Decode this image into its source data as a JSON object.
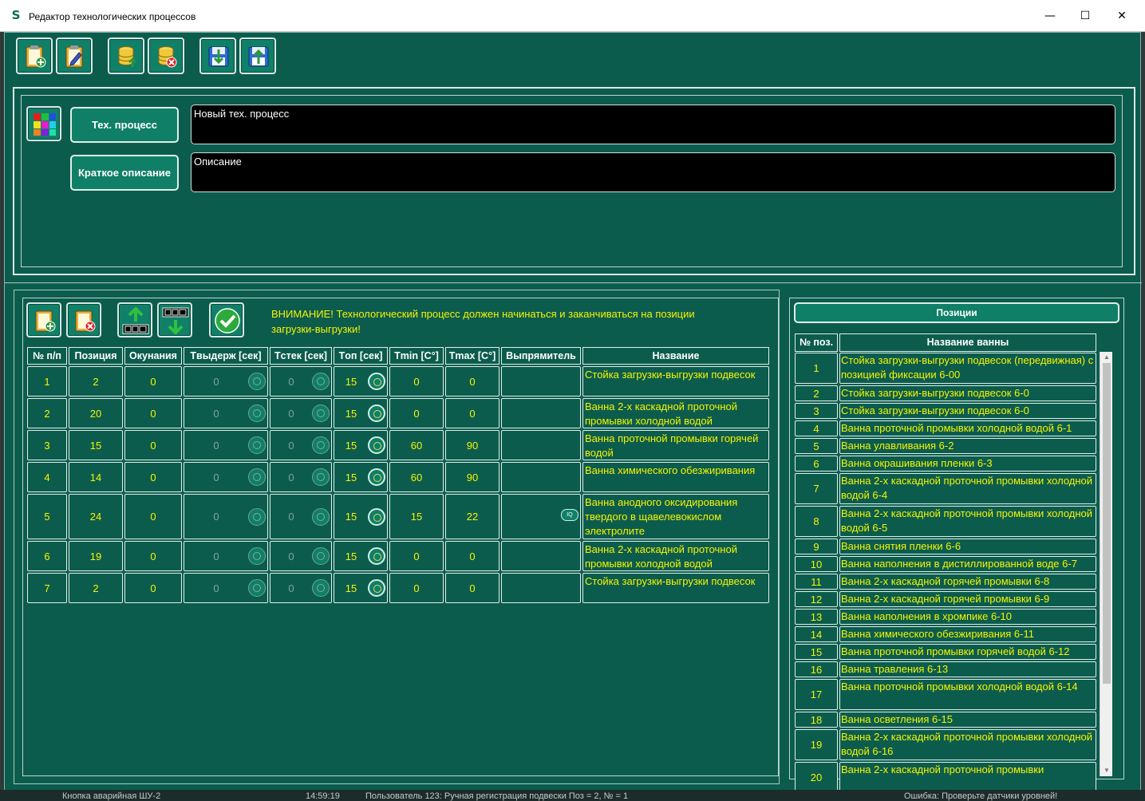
{
  "window": {
    "title": "Редактор технологических процессов",
    "icon_glyph": "S",
    "minimize_glyph": "—",
    "maximize_glyph": "☐",
    "close_glyph": "✕"
  },
  "toolbar": {
    "icons": [
      "new-document-icon",
      "edit-document-icon",
      "db-upload-icon",
      "db-delete-icon",
      "download-to-disk-icon",
      "upload-from-disk-icon"
    ]
  },
  "process": {
    "palette_icon": "color-palette-icon",
    "tech_process_label": "Тех. процесс",
    "tech_process_value": "Новый тех. процесс",
    "description_label": "Краткое описание",
    "description_value": "Описание"
  },
  "steps_toolbar": {
    "icons": [
      "add-step-icon",
      "delete-step-icon",
      "move-up-icon",
      "move-down-icon",
      "confirm-icon"
    ],
    "warning_line1": "ВНИМАНИЕ! Технологический процесс должен начинаться и заканчиваться на позиции",
    "warning_line2": "загрузки-выгрузки!"
  },
  "steps_table": {
    "headers": [
      "№ п/п",
      "Позиция",
      "Окунания",
      "Tвыдерж [сек]",
      "Tстек [сек]",
      "Tоп [сек]",
      "Tmin [C°]",
      "Tmax [C°]",
      "Выпрямитель",
      "Название"
    ],
    "rows": [
      {
        "n": "1",
        "pos": "2",
        "dips": "0",
        "hold": "0",
        "drip": "0",
        "top": "15",
        "tmin": "0",
        "tmax": "0",
        "rect": "",
        "name": "Стойка загрузки-выгрузки подвесок"
      },
      {
        "n": "2",
        "pos": "20",
        "dips": "0",
        "hold": "0",
        "drip": "0",
        "top": "15",
        "tmin": "0",
        "tmax": "0",
        "rect": "",
        "name": "Ванна 2-х каскадной проточной промывки холодной водой"
      },
      {
        "n": "3",
        "pos": "15",
        "dips": "0",
        "hold": "0",
        "drip": "0",
        "top": "15",
        "tmin": "60",
        "tmax": "90",
        "rect": "",
        "name": "Ванна проточной промывки горячей водой"
      },
      {
        "n": "4",
        "pos": "14",
        "dips": "0",
        "hold": "0",
        "drip": "0",
        "top": "15",
        "tmin": "60",
        "tmax": "90",
        "rect": "",
        "name": "Ванна химического обезжиривания"
      },
      {
        "n": "5",
        "pos": "24",
        "dips": "0",
        "hold": "0",
        "drip": "0",
        "top": "15",
        "tmin": "15",
        "tmax": "22",
        "rect": "IQ",
        "name": "Ванна анодного оксидирования твердого в щавелевокислом электролите"
      },
      {
        "n": "6",
        "pos": "19",
        "dips": "0",
        "hold": "0",
        "drip": "0",
        "top": "15",
        "tmin": "0",
        "tmax": "0",
        "rect": "",
        "name": "Ванна 2-х каскадной проточной промывки холодной водой"
      },
      {
        "n": "7",
        "pos": "2",
        "dips": "0",
        "hold": "0",
        "drip": "0",
        "top": "15",
        "tmin": "0",
        "tmax": "0",
        "rect": "",
        "name": "Стойка загрузки-выгрузки подвесок"
      }
    ]
  },
  "positions": {
    "title": "Позиции",
    "headers": [
      "№ поз.",
      "Название ванны"
    ],
    "rows": [
      {
        "n": "1",
        "name": "Стойка загрузки-выгрузки подвесок (передвижная)  с позицией фиксации 6-00"
      },
      {
        "n": "2",
        "name": "Стойка загрузки-выгрузки подвесок 6-0"
      },
      {
        "n": "3",
        "name": "Стойка загрузки-выгрузки подвесок 6-0"
      },
      {
        "n": "4",
        "name": "Ванна проточной промывки холодной водой 6-1"
      },
      {
        "n": "5",
        "name": "Ванна улавливания 6-2"
      },
      {
        "n": "6",
        "name": "Ванна окрашивания пленки 6-3"
      },
      {
        "n": "7",
        "name": "Ванна 2-х каскадной проточной промывки холодной водой 6-4"
      },
      {
        "n": "8",
        "name": "Ванна 2-х каскадной проточной промывки холодной водой 6-5"
      },
      {
        "n": "9",
        "name": "Ванна снятия пленки 6-6"
      },
      {
        "n": "10",
        "name": "Ванна наполнения в дистиллированной воде 6-7"
      },
      {
        "n": "11",
        "name": "Ванна 2-х каскадной горячей промывки 6-8"
      },
      {
        "n": "12",
        "name": "Ванна 2-х каскадной горячей промывки 6-9"
      },
      {
        "n": "13",
        "name": "Ванна наполнения в хромпике 6-10"
      },
      {
        "n": "14",
        "name": "Ванна химического обезжиривания 6-11"
      },
      {
        "n": "15",
        "name": "Ванна проточной промывки горячей водой 6-12"
      },
      {
        "n": "16",
        "name": "Ванна травления 6-13"
      },
      {
        "n": "17",
        "name": "Ванна проточной промывки холодной водой 6-14"
      },
      {
        "n": "18",
        "name": "Ванна осветления 6-15"
      },
      {
        "n": "19",
        "name": "Ванна 2-х каскадной проточной промывки холодной водой 6-16"
      },
      {
        "n": "20",
        "name": "Ванна 2-х каскадной проточной промывки"
      }
    ]
  },
  "scroll": {
    "up": "▲",
    "down": "▼"
  },
  "background_strip": {
    "text1": "Кнопка аварийная ШУ-2",
    "text2": "14:59:19",
    "text3": "Пользователь 123: Ручная регистрация подвески Поз = 2, № = 1",
    "text4": "Ошибка: Проверьте датчики уровней!"
  },
  "colors": {
    "background": "#0c5c4e",
    "accent": "#0f7f67",
    "text_value": "#f5f500",
    "border": "#e0efe9"
  }
}
